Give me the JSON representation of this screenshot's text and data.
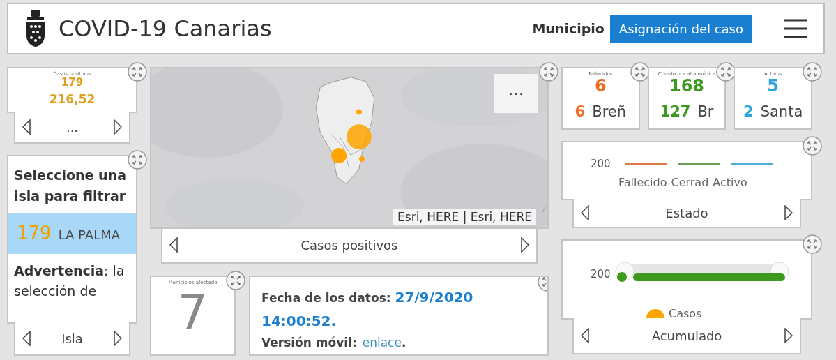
{
  "header": {
    "title": "COVID-19 Canarias",
    "views": [
      {
        "label": "Municipio",
        "selected": true
      },
      {
        "label": "Asignación del caso",
        "selected": false
      }
    ]
  },
  "indicator_card": {
    "title": "Casos positivos",
    "value": "179",
    "rate": "216,52",
    "nav_label": "..."
  },
  "filter_panel": {
    "heading": "Seleccione una isla para filtrar",
    "items": [
      {
        "count": "179",
        "name": "LA PALMA",
        "selected": true
      }
    ],
    "note": "**Advertencia**: la selección de",
    "nav_label": "Isla"
  },
  "map": {
    "menu": "···",
    "attribution": "Esri, HERE | Esri, HERE",
    "nav_label": "Casos positivos"
  },
  "municipios_card": {
    "title": "Municipios afectado",
    "value": "7"
  },
  "info_panel": {
    "lines": [
      {
        "kind": "date",
        "label": "Fecha de los datos:",
        "value": "27/9/2020 14:00:52."
      },
      {
        "kind": "link",
        "label": "Versión móvil:",
        "value": "enlace",
        "suffix": "."
      }
    ]
  },
  "stat_cards": [
    {
      "title": "Fallecidos",
      "value": "6",
      "detail_value": "6",
      "detail_name": "Breñ",
      "color": "#f26b21"
    },
    {
      "title": "Curado por alta médica",
      "value": "168",
      "detail_value": "127",
      "detail_name": "Br",
      "color": "#3e9a1f"
    },
    {
      "title": "Activos",
      "value": "5",
      "detail_value": "2",
      "detail_name": "Santa",
      "color": "#2aa3e0"
    }
  ],
  "estado_chart": {
    "tick": "200",
    "categories": [
      {
        "label": "Fallecido",
        "color": "#e07b4a"
      },
      {
        "label": "Cerrad",
        "color": "#6aa05a"
      },
      {
        "label": "Activo",
        "color": "#4fb0d8"
      }
    ],
    "nav_label": "Estado"
  },
  "acumulado_chart": {
    "tick": "200",
    "slider": {
      "level": 1
    },
    "legend": {
      "label": "Casos",
      "color": "#ffa500"
    },
    "nav_label": "Acumulado"
  }
}
